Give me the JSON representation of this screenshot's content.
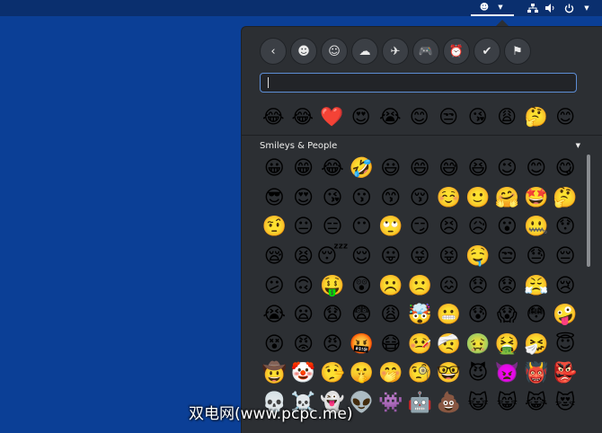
{
  "topbar": {
    "icons": [
      "emoji-indicator-icon",
      "menu-arrow-icon",
      "network-icon",
      "volume-icon",
      "power-icon",
      "menu-arrow-icon"
    ]
  },
  "emoji_picker": {
    "categories": [
      {
        "name": "back",
        "glyph": "‹"
      },
      {
        "name": "smileys",
        "glyph": "☻"
      },
      {
        "name": "people",
        "glyph": "☺"
      },
      {
        "name": "animals",
        "glyph": "☁"
      },
      {
        "name": "travel",
        "glyph": "✈"
      },
      {
        "name": "activities",
        "glyph": "🎮"
      },
      {
        "name": "objects",
        "glyph": "⏰"
      },
      {
        "name": "symbols",
        "glyph": "✔"
      },
      {
        "name": "flags",
        "glyph": "⚑"
      }
    ],
    "search": {
      "value": "",
      "placeholder": ""
    },
    "recent": [
      "😂",
      "😂",
      "❤️",
      "😍",
      "😭",
      "😊",
      "😒",
      "😘",
      "😩",
      "🤔",
      "😊"
    ],
    "section_title": "Smileys & People",
    "grid": [
      "😀",
      "😁",
      "😂",
      "🤣",
      "😃",
      "😄",
      "😅",
      "😆",
      "😉",
      "😊",
      "😋",
      "😎",
      "😍",
      "😘",
      "😗",
      "😙",
      "😚",
      "☺️",
      "🙂",
      "🤗",
      "🤩",
      "🤔",
      "🤨",
      "😐",
      "😑",
      "😶",
      "🙄",
      "😏",
      "😣",
      "😥",
      "😮",
      "🤐",
      "😯",
      "😪",
      "😫",
      "😴",
      "😌",
      "😛",
      "😜",
      "😝",
      "🤤",
      "😒",
      "😓",
      "😔",
      "😕",
      "🙃",
      "🤑",
      "😲",
      "☹️",
      "🙁",
      "😖",
      "😞",
      "😟",
      "😤",
      "😢",
      "😭",
      "😦",
      "😧",
      "😨",
      "😩",
      "🤯",
      "😬",
      "😰",
      "😱",
      "😳",
      "🤪",
      "😵",
      "😡",
      "😠",
      "🤬",
      "😷",
      "🤒",
      "🤕",
      "🤢",
      "🤮",
      "🤧",
      "😇",
      "🤠",
      "🤡",
      "🤥",
      "🤫",
      "🤭",
      "🧐",
      "🤓",
      "😈",
      "👿",
      "👹",
      "👺",
      "💀",
      "☠️",
      "👻",
      "👽",
      "👾",
      "🤖",
      "💩",
      "😺",
      "😸",
      "😹",
      "😻"
    ]
  },
  "watermark": "双电网(www.pcpc.me)"
}
